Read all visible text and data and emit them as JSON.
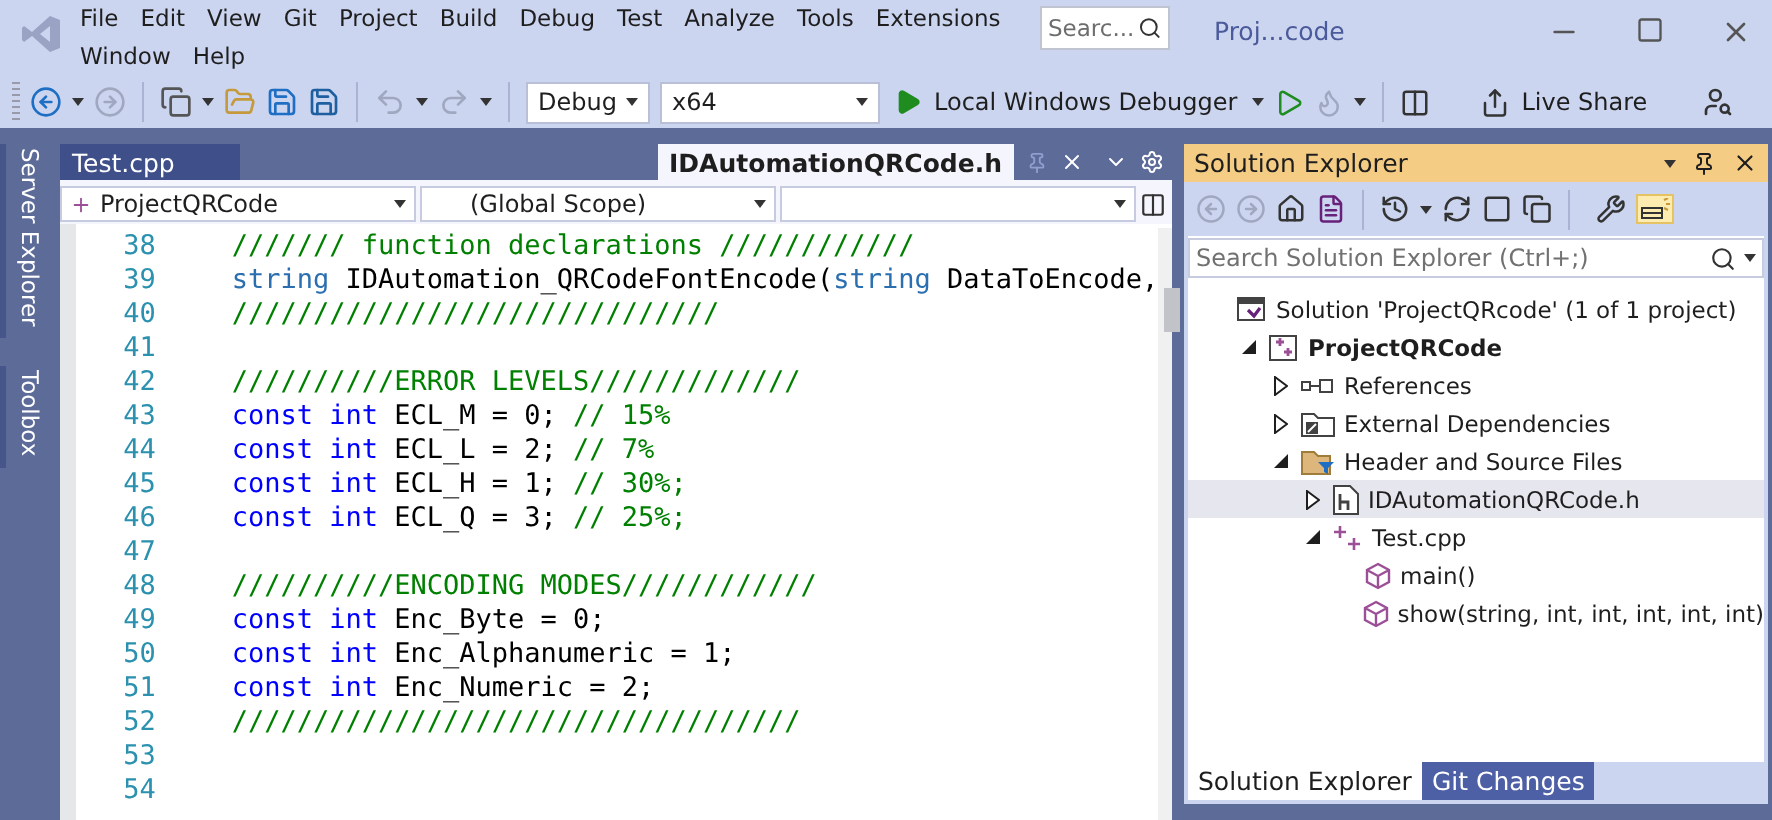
{
  "menu": {
    "items": [
      "File",
      "Edit",
      "View",
      "Git",
      "Project",
      "Build",
      "Debug",
      "Test",
      "Analyze",
      "Tools",
      "Extensions",
      "Window",
      "Help"
    ],
    "search": {
      "placeholder": "Searc..."
    },
    "title": "Proj...code"
  },
  "toolbar": {
    "configuration": "Debug",
    "platform": "x64",
    "debugger": "Local Windows Debugger",
    "live_share": "Live Share"
  },
  "side_tabs": [
    "Server Explorer",
    "Toolbox"
  ],
  "editor": {
    "tabs": [
      {
        "label": "Test.cpp",
        "selected": false
      },
      {
        "label": "IDAutomationQRCode.h",
        "selected": true
      }
    ],
    "navigation": {
      "project": "ProjectQRCode",
      "scope": "(Global Scope)"
    },
    "lines": [
      {
        "number": "38",
        "tokens": [
          {
            "kind": "comment",
            "text": "/////// function declarations ////////////"
          }
        ]
      },
      {
        "number": "39",
        "tokens": [
          {
            "kind": "type",
            "text": "string"
          },
          {
            "kind": "plain",
            "text": " IDAutomation_QRCodeFontEncode("
          },
          {
            "kind": "type",
            "text": "string"
          },
          {
            "kind": "plain",
            "text": " DataToEncode,"
          }
        ]
      },
      {
        "number": "40",
        "tokens": [
          {
            "kind": "comment",
            "text": "//////////////////////////////"
          }
        ]
      },
      {
        "number": "41"
      },
      {
        "number": "42",
        "tokens": [
          {
            "kind": "comment",
            "text": "//////////ERROR LEVELS/////////////"
          }
        ]
      },
      {
        "number": "43",
        "tokens": [
          {
            "kind": "keyword",
            "text": "const int"
          },
          {
            "kind": "plain",
            "text": " ECL_M = 0; "
          },
          {
            "kind": "comment",
            "text": "// 15%"
          }
        ]
      },
      {
        "number": "44",
        "tokens": [
          {
            "kind": "keyword",
            "text": "const int"
          },
          {
            "kind": "plain",
            "text": " ECL_L = 2; "
          },
          {
            "kind": "comment",
            "text": "// 7%"
          }
        ]
      },
      {
        "number": "45",
        "tokens": [
          {
            "kind": "keyword",
            "text": "const int"
          },
          {
            "kind": "plain",
            "text": " ECL_H = 1; "
          },
          {
            "kind": "comment",
            "text": "// 30%;"
          }
        ]
      },
      {
        "number": "46",
        "tokens": [
          {
            "kind": "keyword",
            "text": "const int"
          },
          {
            "kind": "plain",
            "text": " ECL_Q = 3; "
          },
          {
            "kind": "comment",
            "text": "// 25%;"
          }
        ]
      },
      {
        "number": "47"
      },
      {
        "number": "48",
        "tokens": [
          {
            "kind": "comment",
            "text": "//////////ENCODING MODES////////////"
          }
        ]
      },
      {
        "number": "49",
        "tokens": [
          {
            "kind": "keyword",
            "text": "const int"
          },
          {
            "kind": "plain",
            "text": " Enc_Byte = 0;"
          }
        ]
      },
      {
        "number": "50",
        "tokens": [
          {
            "kind": "keyword",
            "text": "const int"
          },
          {
            "kind": "plain",
            "text": " Enc_Alphanumeric = 1;"
          }
        ]
      },
      {
        "number": "51",
        "tokens": [
          {
            "kind": "keyword",
            "text": "const int"
          },
          {
            "kind": "plain",
            "text": " Enc_Numeric = 2;"
          }
        ]
      },
      {
        "number": "52",
        "tokens": [
          {
            "kind": "comment",
            "text": "///////////////////////////////////"
          }
        ]
      },
      {
        "number": "53"
      },
      {
        "number": "54"
      }
    ]
  },
  "solution_explorer": {
    "title": "Solution Explorer",
    "search": {
      "placeholder": "Search Solution Explorer (Ctrl+;)"
    },
    "tree": [
      {
        "kind": "solution",
        "label": "Solution 'ProjectQRcode' (1 of 1 project)",
        "selected": false,
        "children": [
          {
            "kind": "project",
            "label": "ProjectQRCode",
            "expanded": true,
            "selected": false,
            "children": [
              {
                "kind": "references",
                "label": "References",
                "expanded": false,
                "selected": false
              },
              {
                "kind": "external",
                "label": "External Dependencies",
                "expanded": false,
                "selected": false
              },
              {
                "kind": "folder",
                "label": "Header and Source Files",
                "expanded": true,
                "selected": false,
                "children": [
                  {
                    "kind": "header",
                    "label": "IDAutomationQRCode.h",
                    "expanded": false,
                    "selected": true
                  },
                  {
                    "kind": "cpp",
                    "label": "Test.cpp",
                    "expanded": true,
                    "selected": false,
                    "children": [
                      {
                        "kind": "method",
                        "label": "main()",
                        "selected": false
                      },
                      {
                        "kind": "method",
                        "label": "show(string, int, int, int, int, int)",
                        "selected": false
                      }
                    ]
                  }
                ]
              }
            ]
          }
        ]
      }
    ],
    "bottom_tabs": [
      {
        "label": "Solution Explorer",
        "selected": true
      },
      {
        "label": "Git Changes",
        "selected": false
      }
    ]
  }
}
